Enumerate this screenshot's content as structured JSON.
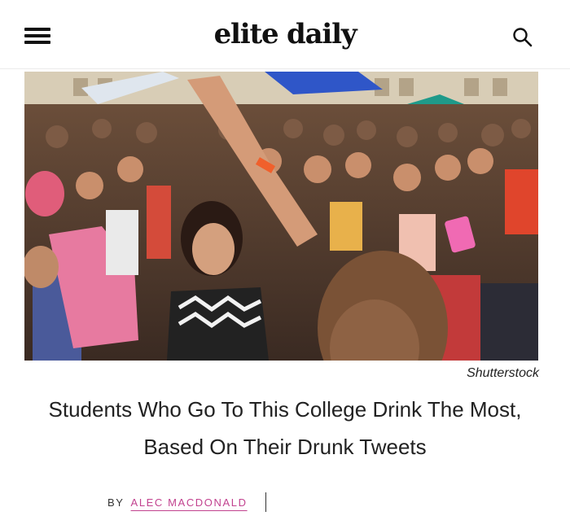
{
  "header": {
    "logo_text": "elite daily",
    "menu_icon": "hamburger-menu-icon",
    "search_icon": "search-icon"
  },
  "hero": {
    "credit": "Shutterstock"
  },
  "article": {
    "headline": "Students Who Go To This College Drink The Most, Based On Their Drunk Tweets",
    "byline_prefix": "BY",
    "author": "ALEC MACDONALD"
  },
  "colors": {
    "author_link": "#c2428f",
    "text": "#222222"
  }
}
